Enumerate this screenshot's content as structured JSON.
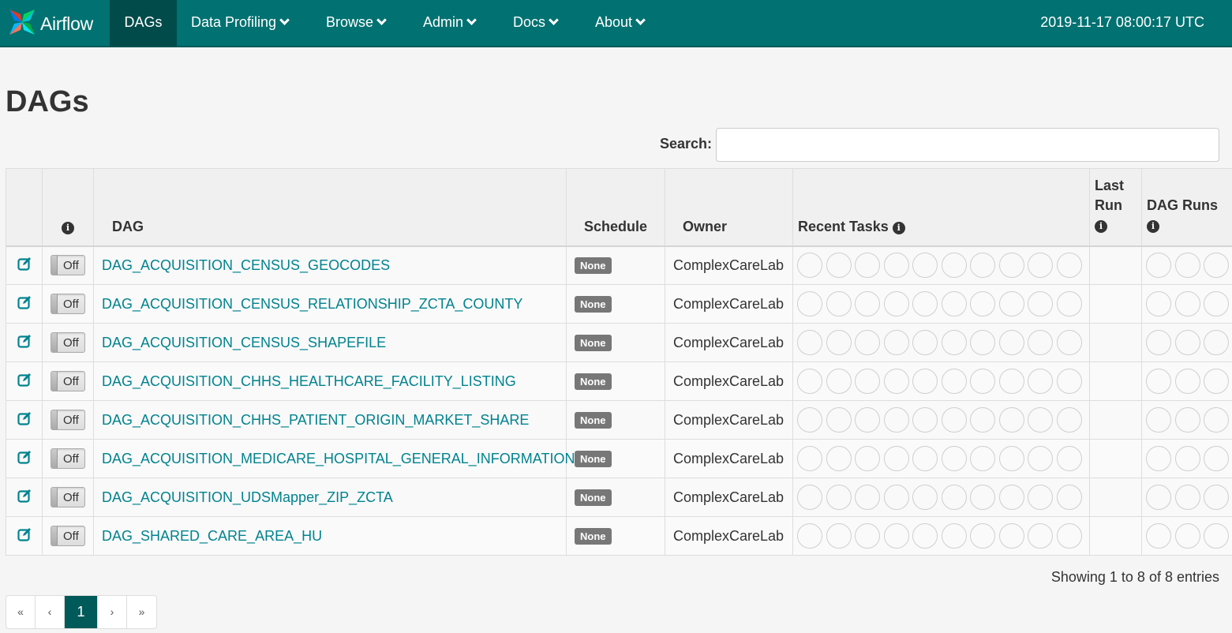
{
  "navbar": {
    "brand": "Airflow",
    "items": [
      {
        "label": "DAGs",
        "dropdown": false,
        "active": true
      },
      {
        "label": "Data Profiling",
        "dropdown": true
      },
      {
        "label": "Browse",
        "dropdown": true
      },
      {
        "label": "Admin",
        "dropdown": true
      },
      {
        "label": "Docs",
        "dropdown": true
      },
      {
        "label": "About",
        "dropdown": true
      }
    ],
    "time": "2019-11-17 08:00:17 UTC"
  },
  "page": {
    "title": "DAGs",
    "search_label": "Search:",
    "search_value": ""
  },
  "table": {
    "headers": {
      "dag": "DAG",
      "schedule": "Schedule",
      "owner": "Owner",
      "recent_tasks": "Recent Tasks",
      "last_run": "Last Run",
      "dag_runs": "DAG Runs"
    },
    "rows": [
      {
        "dag": "DAG_ACQUISITION_CENSUS_GEOCODES",
        "toggle": "Off",
        "schedule": "None",
        "owner": "ComplexCareLab"
      },
      {
        "dag": "DAG_ACQUISITION_CENSUS_RELATIONSHIP_ZCTA_COUNTY",
        "toggle": "Off",
        "schedule": "None",
        "owner": "ComplexCareLab"
      },
      {
        "dag": "DAG_ACQUISITION_CENSUS_SHAPEFILE",
        "toggle": "Off",
        "schedule": "None",
        "owner": "ComplexCareLab"
      },
      {
        "dag": "DAG_ACQUISITION_CHHS_HEALTHCARE_FACILITY_LISTING",
        "toggle": "Off",
        "schedule": "None",
        "owner": "ComplexCareLab"
      },
      {
        "dag": "DAG_ACQUISITION_CHHS_PATIENT_ORIGIN_MARKET_SHARE",
        "toggle": "Off",
        "schedule": "None",
        "owner": "ComplexCareLab"
      },
      {
        "dag": "DAG_ACQUISITION_MEDICARE_HOSPITAL_GENERAL_INFORMATION",
        "toggle": "Off",
        "schedule": "None",
        "owner": "ComplexCareLab"
      },
      {
        "dag": "DAG_ACQUISITION_UDSMapper_ZIP_ZCTA",
        "toggle": "Off",
        "schedule": "None",
        "owner": "ComplexCareLab"
      },
      {
        "dag": "DAG_SHARED_CARE_AREA_HU",
        "toggle": "Off",
        "schedule": "None",
        "owner": "ComplexCareLab"
      }
    ],
    "recent_task_circles": 10,
    "dag_run_circles": 3
  },
  "footer": {
    "showing": "Showing 1 to 8 of 8 entries",
    "pagination": [
      "«",
      "‹",
      "1",
      "›",
      "»"
    ],
    "current_page": "1"
  },
  "colors": {
    "navbar": "#017171",
    "navbar_active": "#014b4b",
    "link": "#00838f",
    "badge": "#777777"
  }
}
